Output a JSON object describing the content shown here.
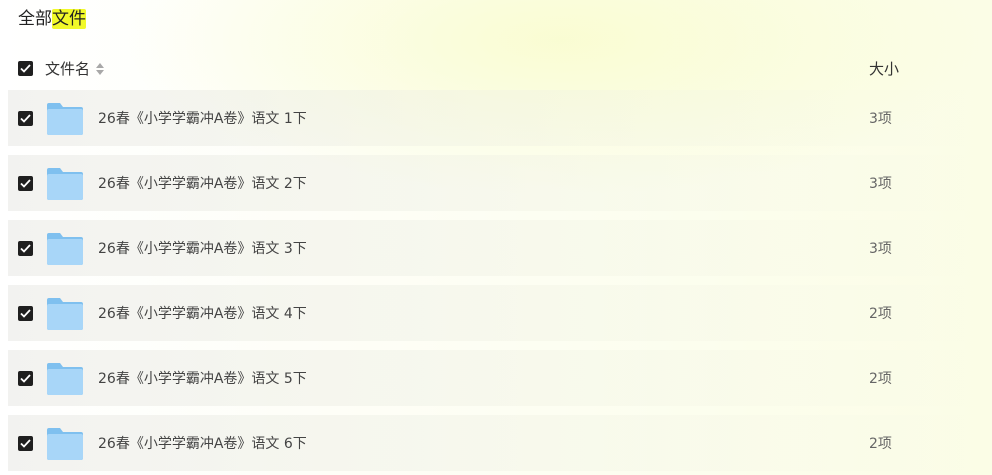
{
  "breadcrumb": {
    "part1": "全部",
    "part2": "文件"
  },
  "header": {
    "name_label": "文件名",
    "size_label": "大小",
    "select_all_checked": true
  },
  "files": [
    {
      "name": "26春《小学学霸冲A卷》语文 1下",
      "size": "3项",
      "checked": true
    },
    {
      "name": "26春《小学学霸冲A卷》语文 2下",
      "size": "3项",
      "checked": true
    },
    {
      "name": "26春《小学学霸冲A卷》语文 3下",
      "size": "3项",
      "checked": true
    },
    {
      "name": "26春《小学学霸冲A卷》语文 4下",
      "size": "2项",
      "checked": true
    },
    {
      "name": "26春《小学学霸冲A卷》语文 5下",
      "size": "2项",
      "checked": true
    },
    {
      "name": "26春《小学学霸冲A卷》语文 6下",
      "size": "2项",
      "checked": true
    }
  ],
  "colors": {
    "folder_front": "#a8d6f8",
    "folder_back": "#7fc0ef",
    "checkbox": "#1f1f1f",
    "highlight": "#f1f92a"
  },
  "icons": {
    "row_icon": "folder-icon",
    "checkbox_icon": "checkmark-icon",
    "sort_icon": "sort-icon"
  }
}
